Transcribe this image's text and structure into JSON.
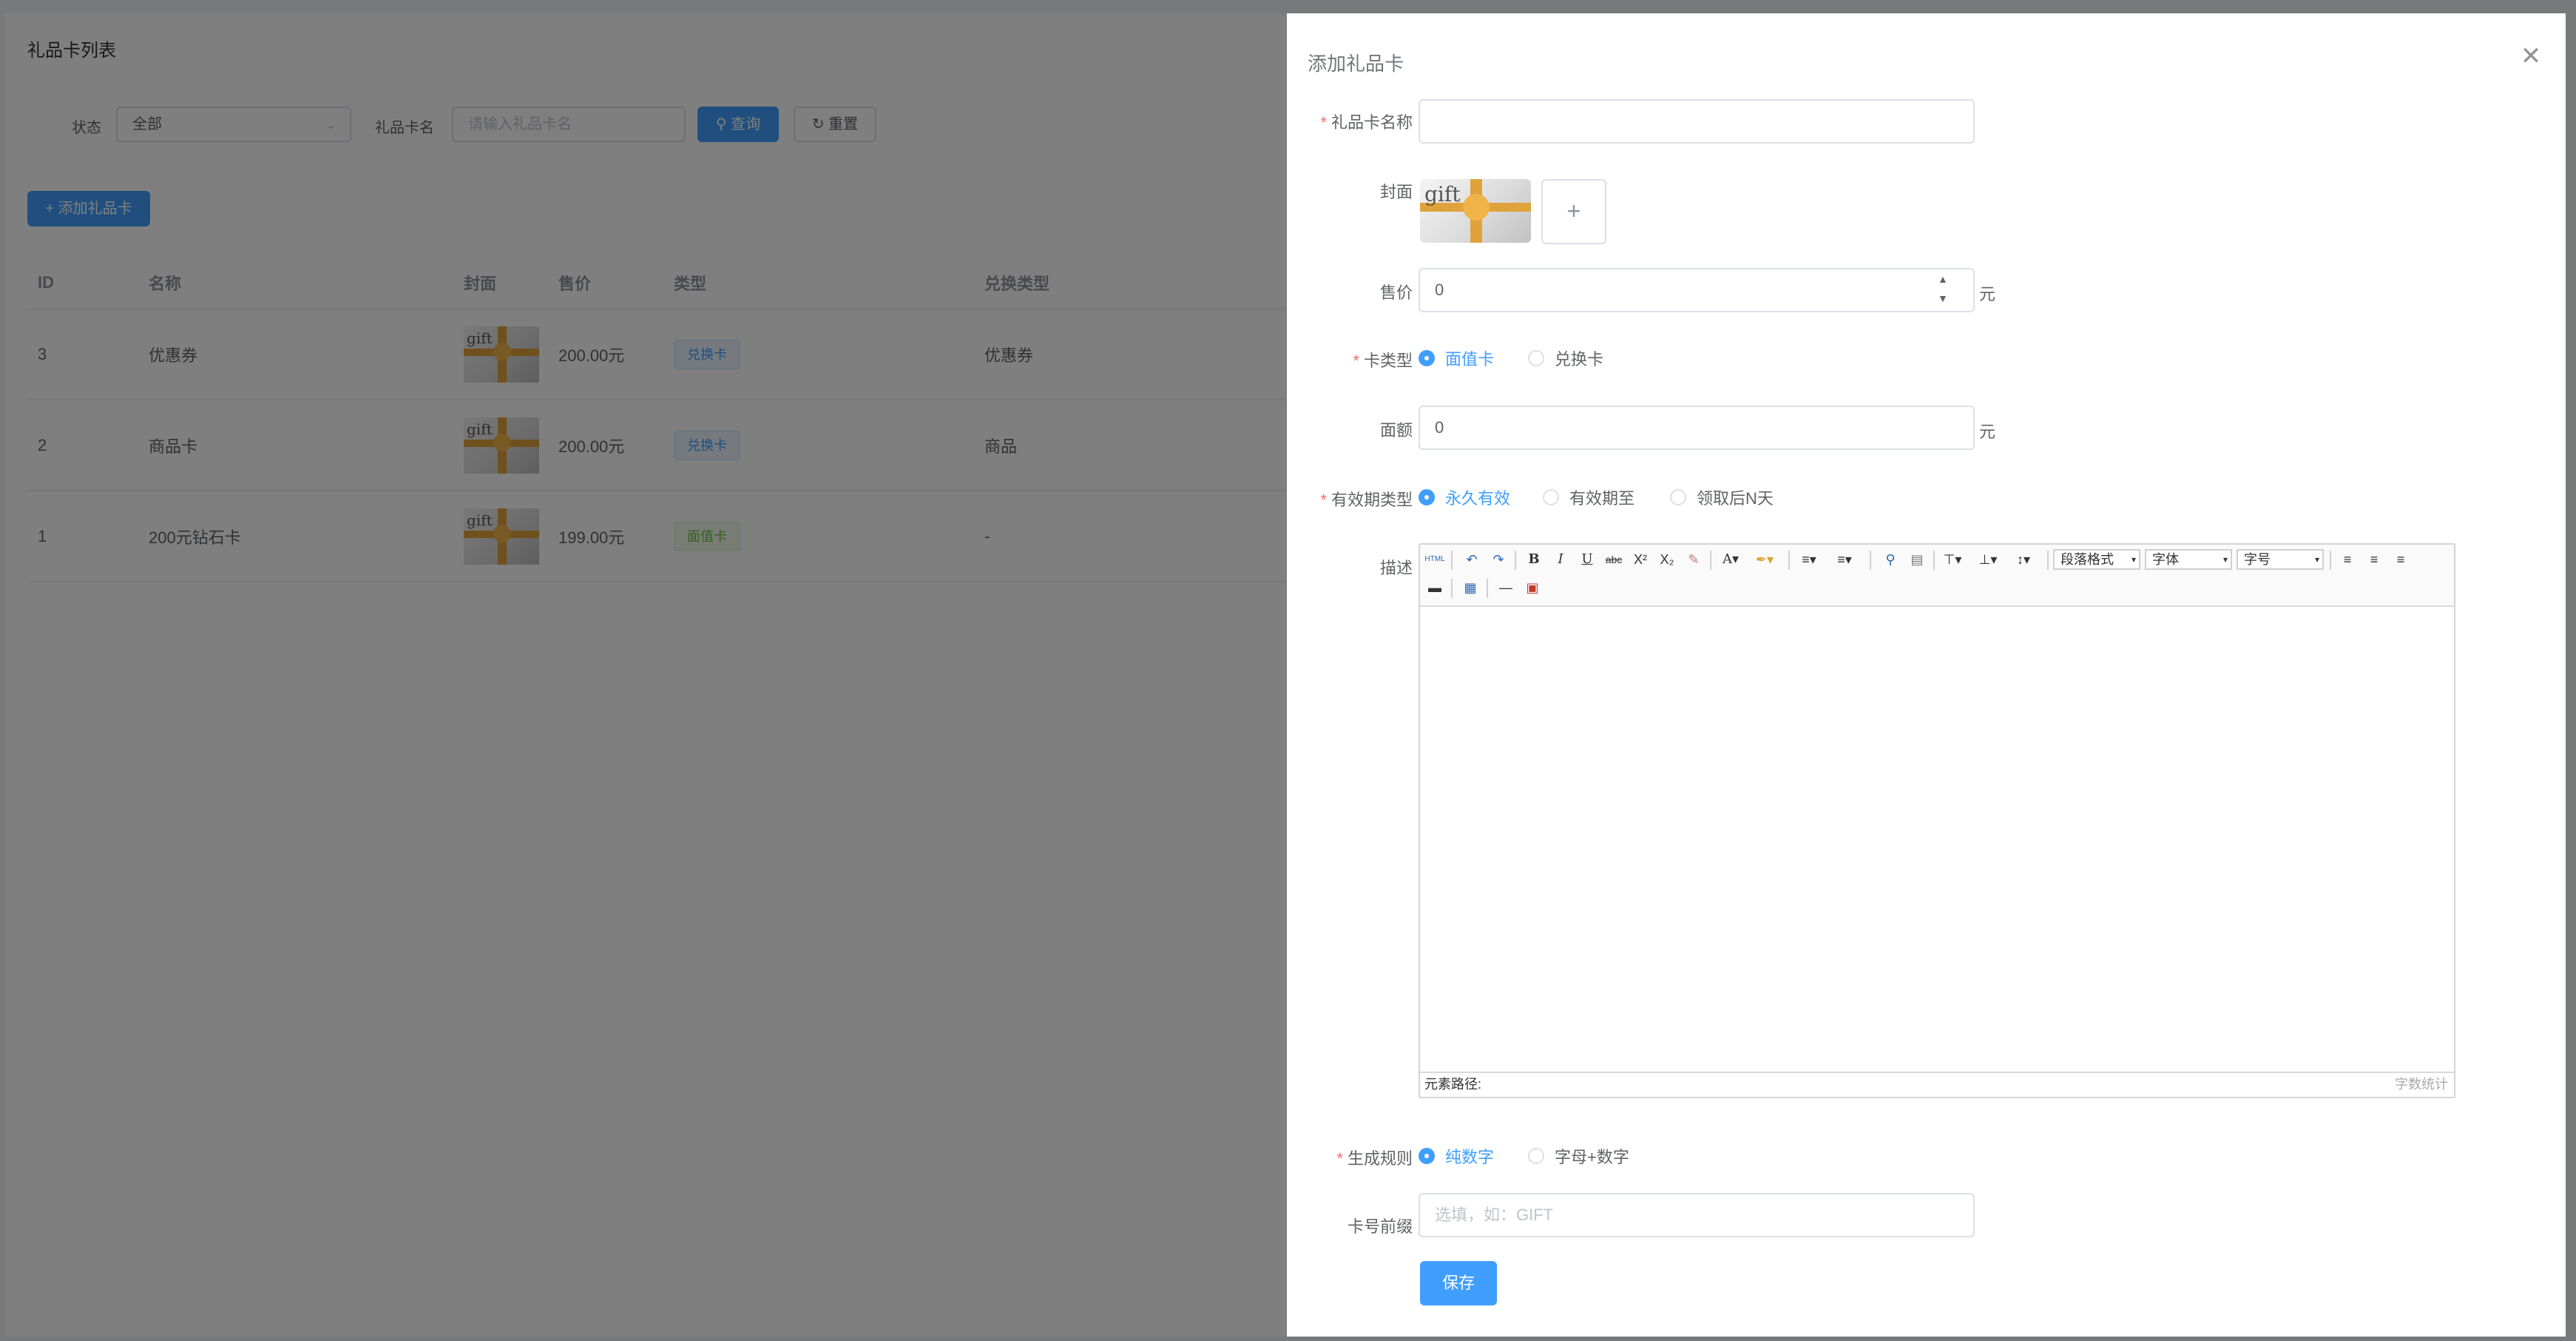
{
  "list": {
    "title": "礼品卡列表",
    "filters": {
      "status_label": "状态",
      "status_value": "全部",
      "name_label": "礼品卡名",
      "name_placeholder": "请输入礼品卡名",
      "search_label": "查询",
      "reset_label": "重置"
    },
    "add_button": "添加礼品卡",
    "columns": [
      "ID",
      "名称",
      "封面",
      "售价",
      "类型",
      "兑换类型"
    ],
    "rows": [
      {
        "id": "3",
        "name": "优惠券",
        "cover_text": "gift",
        "price": "200.00元",
        "type": "兑换卡",
        "redeem_type": "优惠券"
      },
      {
        "id": "2",
        "name": "商品卡",
        "cover_text": "gift",
        "price": "200.00元",
        "type": "兑换卡",
        "redeem_type": "商品"
      },
      {
        "id": "1",
        "name": "200元钻石卡",
        "cover_text": "gift",
        "price": "199.00元",
        "type": "面值卡",
        "redeem_type": "-"
      }
    ]
  },
  "drawer": {
    "title": "添加礼品卡",
    "form": {
      "name_label": "礼品卡名称",
      "name_value": "",
      "cover_label": "封面",
      "cover_text": "gift",
      "price_label": "售价",
      "price_value": "0",
      "price_unit": "元",
      "card_type_label": "卡类型",
      "card_type_options": [
        "面值卡",
        "兑换卡"
      ],
      "card_type_selected": "面值卡",
      "face_value_label": "面额",
      "face_value_value": "0",
      "face_value_unit": "元",
      "validity_label": "有效期类型",
      "validity_options": [
        "永久有效",
        "有效期至",
        "领取后N天"
      ],
      "validity_selected": "永久有效",
      "desc_label": "描述",
      "editor": {
        "combo_paragraph": "段落格式",
        "combo_font": "字体",
        "combo_size": "字号",
        "path_label": "元素路径:",
        "count_label": "字数统计"
      },
      "rule_label": "生成规则",
      "rule_options": [
        "纯数字",
        "字母+数字"
      ],
      "rule_selected": "纯数字",
      "prefix_label": "卡号前缀",
      "prefix_placeholder": "选填，如：GIFT",
      "save_label": "保存"
    }
  },
  "colors": {
    "primary": "#409eff",
    "danger": "#f56c6c",
    "success": "#67c23a",
    "mask": "rgba(0,0,0,0.5)"
  }
}
